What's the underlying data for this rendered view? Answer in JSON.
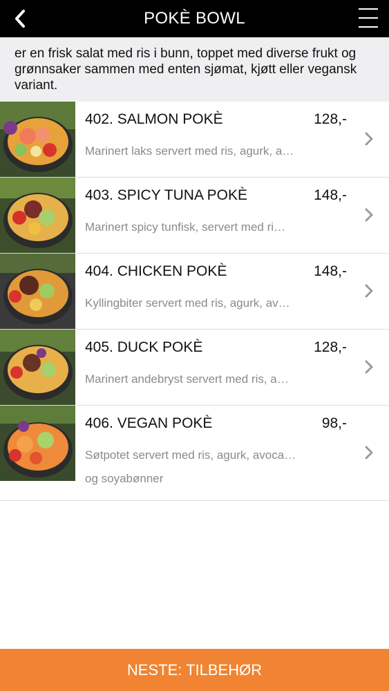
{
  "header": {
    "title": "POKÈ BOWL",
    "back_icon": "chevron-left-icon",
    "menu_icon": "hamburger-menu-icon"
  },
  "intro": {
    "text": "er en frisk salat med ris i bunn, toppet med diverse frukt og grønnsaker sammen med enten sjømat, kjøtt eller vegansk variant."
  },
  "items": [
    {
      "title": "402. SALMON POKÈ",
      "price": "128,-",
      "desc": "Marinert laks servert med ris, agurk, a…",
      "desc2": ""
    },
    {
      "title": "403. SPICY TUNA POKÈ",
      "price": "148,-",
      "desc": "Marinert spicy tunfisk, servert med ri…",
      "desc2": ""
    },
    {
      "title": "404. CHICKEN POKÈ",
      "price": "148,-",
      "desc": "Kyllingbiter servert med ris, agurk, av…",
      "desc2": ""
    },
    {
      "title": "405. DUCK POKÈ",
      "price": "128,-",
      "desc": "Marinert andebryst servert med ris, a…",
      "desc2": ""
    },
    {
      "title": "406. VEGAN POKÈ",
      "price": "98,-",
      "desc": "Søtpotet servert med ris, agurk, avoca…",
      "desc2": "og soyabønner"
    }
  ],
  "footer": {
    "label": "NESTE: TILBEHØR"
  },
  "colors": {
    "header_bg": "#000000",
    "intro_bg": "#efeff1",
    "accent": "#f08432",
    "muted_text": "#8a8a8a"
  }
}
